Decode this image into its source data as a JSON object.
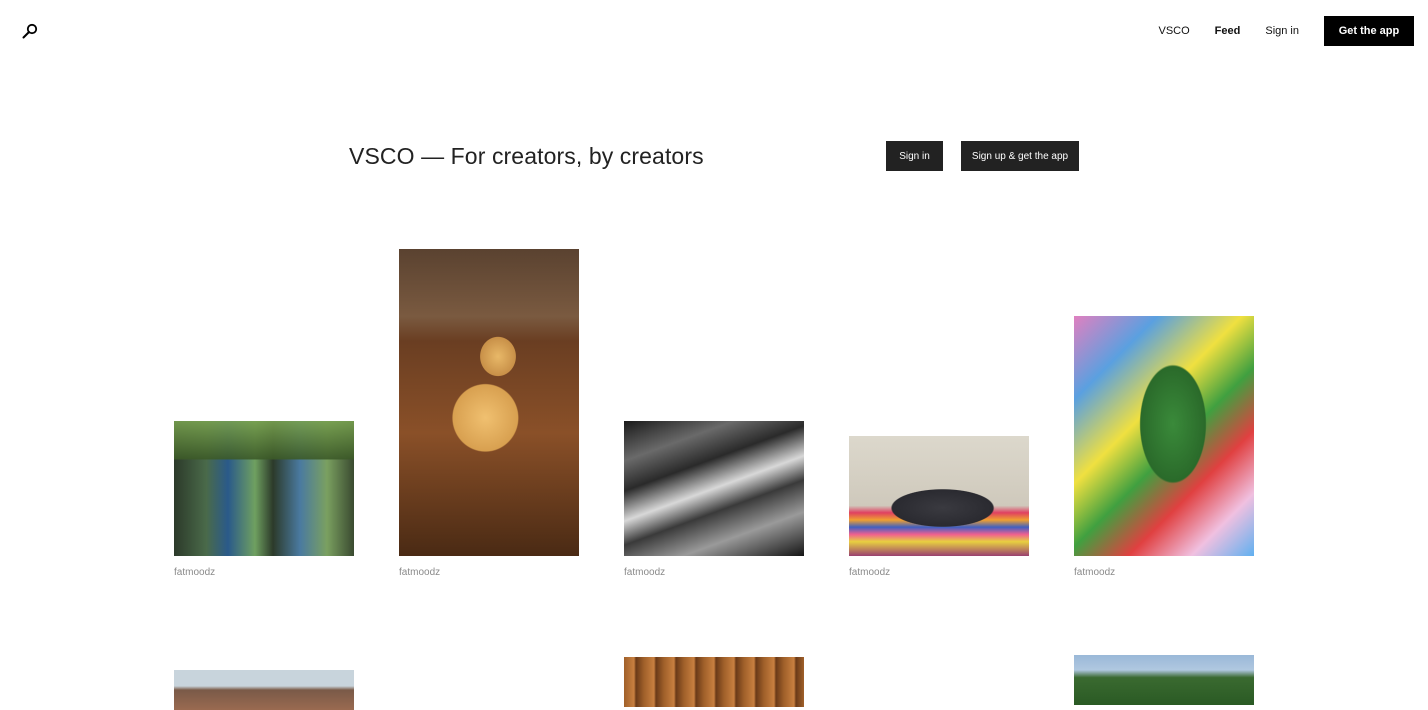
{
  "nav": {
    "search_icon": "search-icon",
    "links": [
      {
        "label": "VSCO"
      },
      {
        "label": "Feed"
      },
      {
        "label": "Sign in"
      }
    ],
    "cta": "Get the app"
  },
  "hero": {
    "title": "VSCO — For creators, by creators",
    "signin": "Sign in",
    "signup": "Sign up & get the app"
  },
  "feed": {
    "row1": [
      {
        "author": "fatmoodz"
      },
      {
        "author": "fatmoodz"
      },
      {
        "author": "fatmoodz"
      },
      {
        "author": "fatmoodz"
      },
      {
        "author": "fatmoodz"
      }
    ]
  },
  "colors": {
    "accent": "#000000",
    "button": "#222222",
    "caption": "#8a8a8a"
  }
}
